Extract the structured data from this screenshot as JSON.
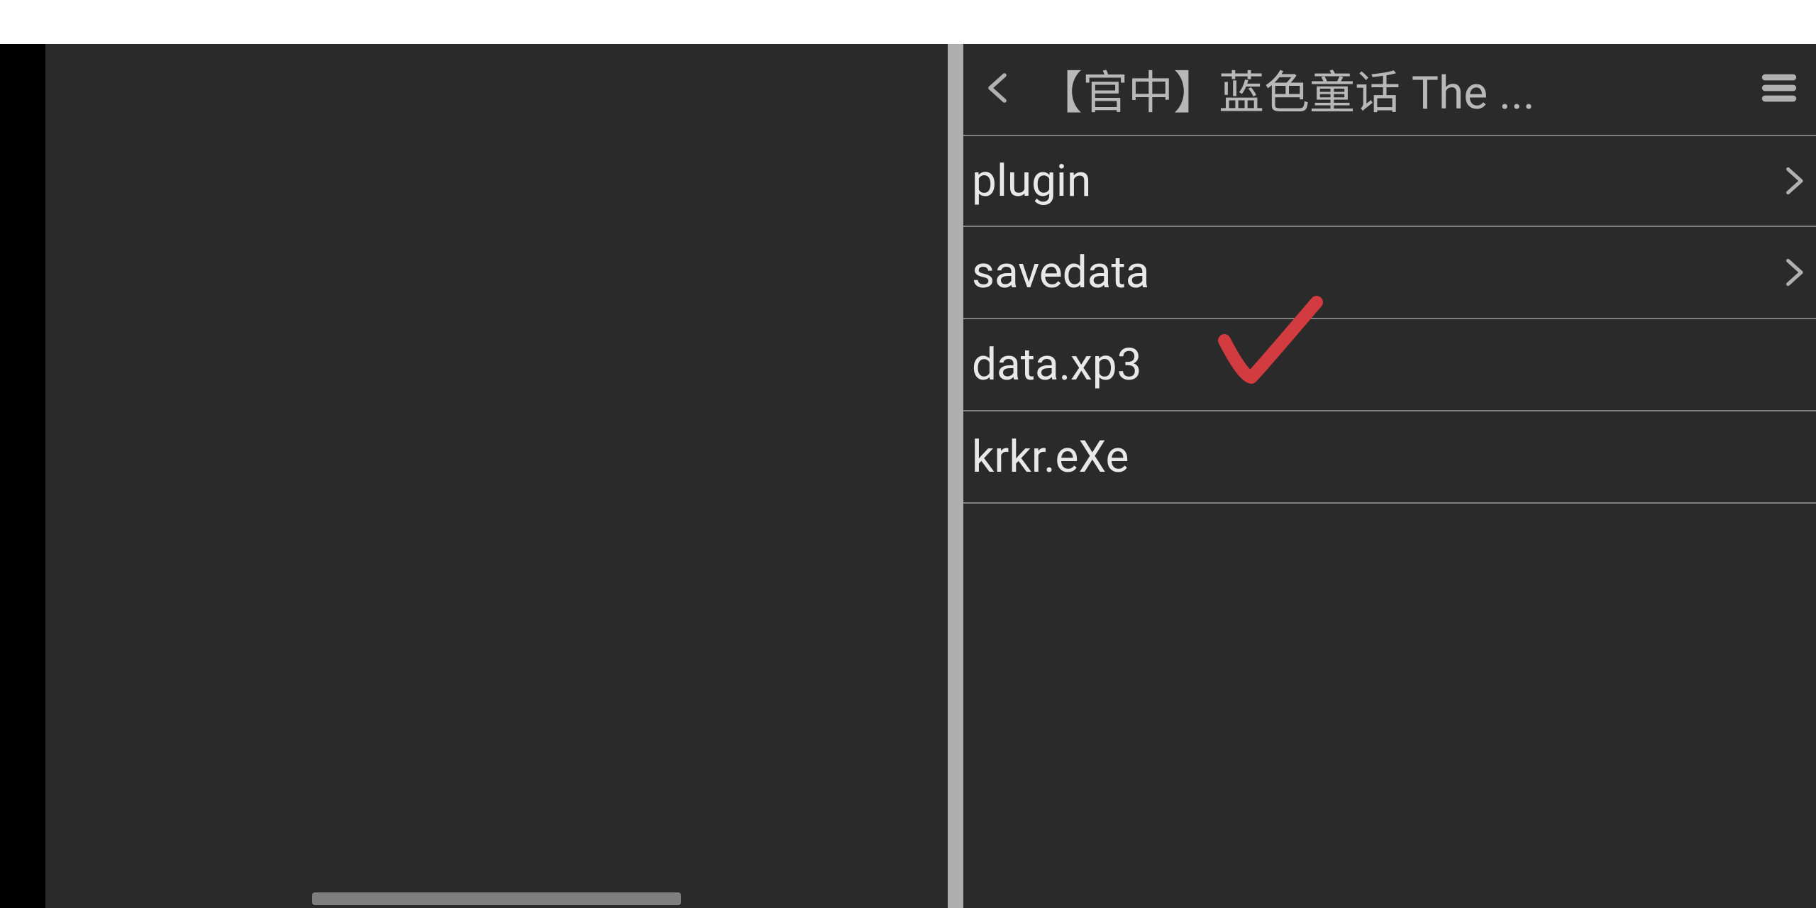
{
  "header": {
    "title": "【官中】蓝色童话 The ..."
  },
  "files": {
    "row0": {
      "label": "plugin",
      "is_folder": true
    },
    "row1": {
      "label": "savedata",
      "is_folder": true
    },
    "row2": {
      "label": "data.xp3",
      "is_folder": false,
      "annotated": true
    },
    "row3": {
      "label": "krkr.eXe",
      "is_folder": false
    }
  },
  "colors": {
    "bg": "#2a2a2a",
    "divider": "#808080",
    "text": "#e8e8e8",
    "title_text": "#b8b8b8",
    "annotation": "#d23b3f"
  }
}
